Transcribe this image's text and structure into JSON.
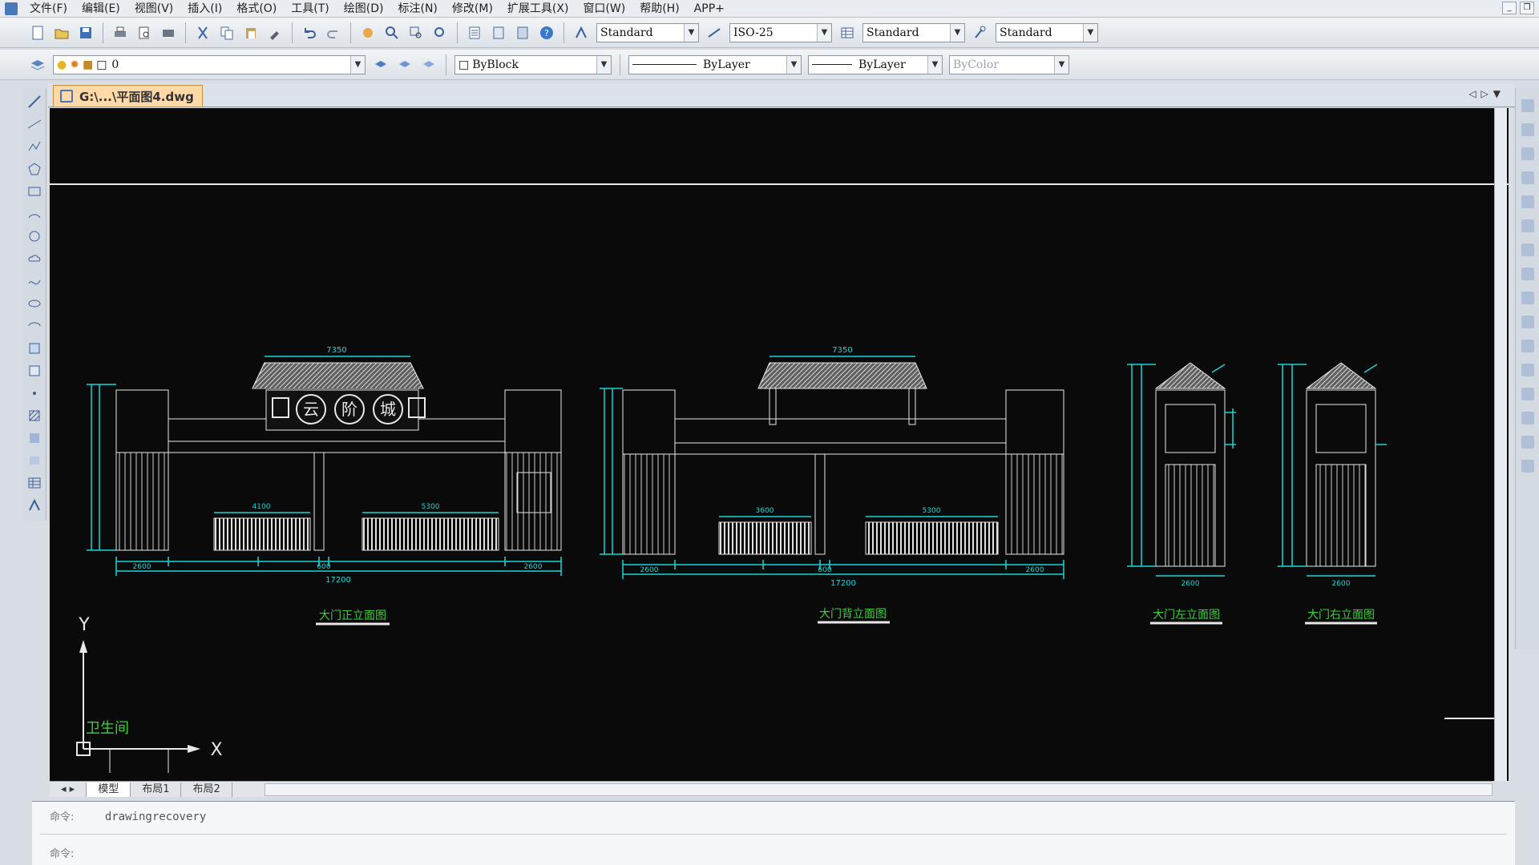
{
  "menubar": {
    "items": [
      "文件(F)",
      "编辑(E)",
      "视图(V)",
      "插入(I)",
      "格式(O)",
      "工具(T)",
      "绘图(D)",
      "标注(N)",
      "修改(M)",
      "扩展工具(X)",
      "窗口(W)",
      "帮助(H)",
      "APP+"
    ]
  },
  "toolbar1": {
    "text_style": "Standard",
    "dim_style": "ISO-25",
    "table_style": "Standard",
    "multileader_style": "Standard"
  },
  "toolbar2": {
    "layer": "0",
    "color": "ByBlock",
    "linetype": "ByLayer",
    "lineweight": "ByLayer",
    "plot_style": "ByColor"
  },
  "document": {
    "tab_title": "G:\\...\\平面图4.dwg"
  },
  "drawing": {
    "sign_chars": [
      "云",
      "阶",
      "城"
    ],
    "elevations": [
      {
        "title": "大门正立面图",
        "total": "17200",
        "top": "7350",
        "segs": [
          "2600",
          "4100",
          "600",
          "5300",
          "2600"
        ]
      },
      {
        "title": "大门背立面图",
        "total": "17200",
        "top": "7350",
        "segs": [
          "2600",
          "3600",
          "600",
          "5300",
          "2600"
        ]
      },
      {
        "title": "大门左立面图",
        "total": "2600",
        "top": "",
        "segs": []
      },
      {
        "title": "大门右立面图",
        "total": "2600",
        "top": "",
        "segs": []
      }
    ],
    "ucs": {
      "x": "X",
      "y": "Y"
    },
    "room_label": "卫生间"
  },
  "layout_tabs": [
    "模型",
    "布局1",
    "布局2"
  ],
  "command": {
    "prompt": "命令:",
    "history": "drawingrecovery"
  },
  "colors": {
    "cyan": "#19d6d6",
    "white": "#e8e8e8",
    "green": "#3cd23c",
    "bg": "#0a0a0a"
  }
}
